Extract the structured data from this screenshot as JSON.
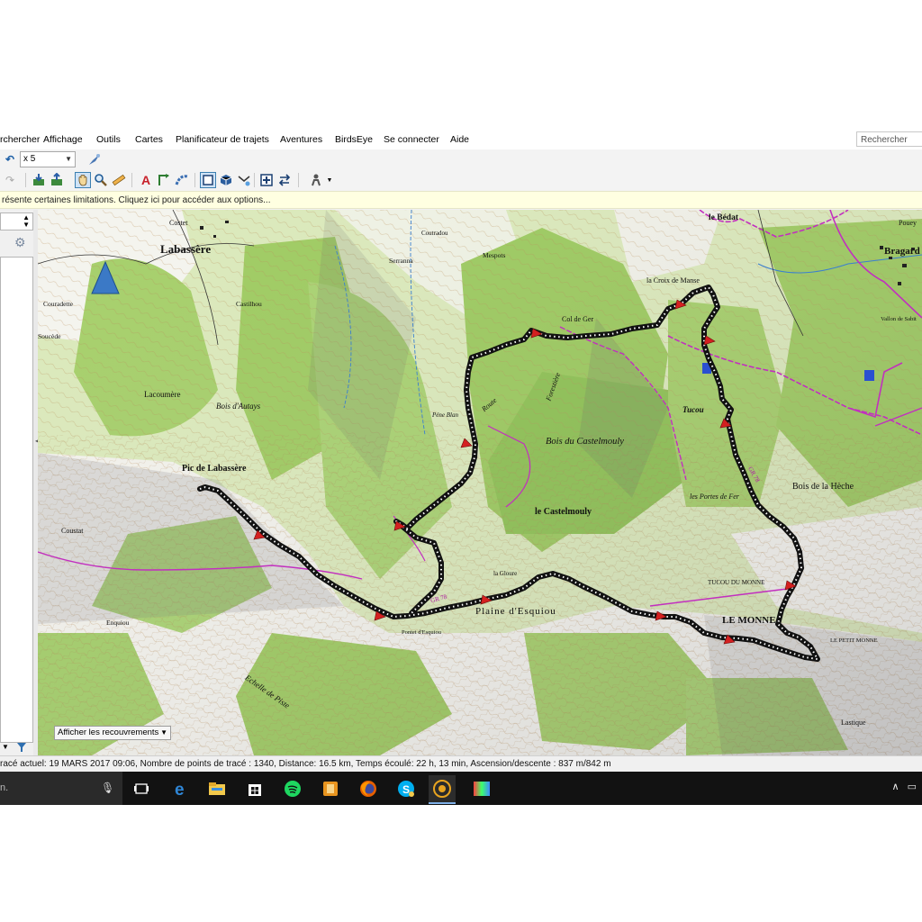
{
  "menu": {
    "items": [
      "rchercher",
      "Affichage",
      "Outils",
      "Cartes",
      "Planificateur de trajets",
      "Aventures",
      "BirdsEye",
      "Se connecter",
      "Aide"
    ],
    "search_placeholder": "Rechercher"
  },
  "toolbar": {
    "zoom_value": "x 5"
  },
  "infobar": {
    "text": "résente certaines limitations. Cliquez ici pour accéder aux options..."
  },
  "map": {
    "overlay_select": "Afficher les recouvrements",
    "labels": {
      "labassere": "Labassère",
      "pic_labassere": "Pic de Labassère",
      "bois_castelmouly": "Bois du Castelmouly",
      "le_castelmouly": "le Castelmouly",
      "plaine_esquiou": "Plaine d'Esquiou",
      "le_monne": "LE MONNE",
      "bragard": "Bragard",
      "le_bedat": "le Bédat",
      "bois_heche": "Bois de la Hèche",
      "col_de_ger": "Col de Ger",
      "croix_manse": "la Croix de Manse",
      "bois_autays": "Bois d'Autays",
      "lacoumere": "Lacoumère",
      "tucou": "Tucou",
      "tucou_monne": "TUCOU DU MONNE",
      "le_petit_monne": "LE PETIT MONNE",
      "peme_blan": "Péne Blan",
      "route": "Route",
      "foresriere": "Forestière",
      "seranna": "Serranna",
      "mespots": "Mespots",
      "courriadou": "Coutradou",
      "lastique": "Lastique",
      "echelle": "Echelle de Piste",
      "le_gloutou": "la Gloure",
      "pontet": "Pontet d'Esquiou",
      "enquiou": "Enquiou",
      "coustat": "Coustat",
      "costet": "Costet",
      "poue": "Pouey",
      "gr78": "GR 78",
      "gr78b": "GR 78",
      "portes_fer": "les Portes de Fer",
      "castilhou": "Castilhou",
      "couradette": "Couradette",
      "soucede": "Soucède",
      "vallon": "Vallon de Sabit"
    }
  },
  "statusbar": {
    "text": "racé actuel: 19 MARS 2017 09:06, Nombre de points de tracé : 1340, Distance: 16.5 km, Temps écoulé: 22 h, 13 min, Ascension/descente : 837 m/842 m"
  },
  "taskbar": {
    "search_text": "n.",
    "apps": [
      "task-view-icon",
      "edge-icon",
      "file-explorer-icon",
      "store-icon",
      "spotify-icon",
      "app-icon",
      "firefox-icon",
      "skype-icon",
      "basecamp-icon",
      "photos-icon"
    ]
  },
  "colors": {
    "track": "#111111",
    "track_dots": "#ffffff",
    "waypoint": "#d42020",
    "trail": "#c22fbf",
    "forest": "#9cc95f",
    "open": "#ffffff",
    "taskbar": "#121212"
  }
}
